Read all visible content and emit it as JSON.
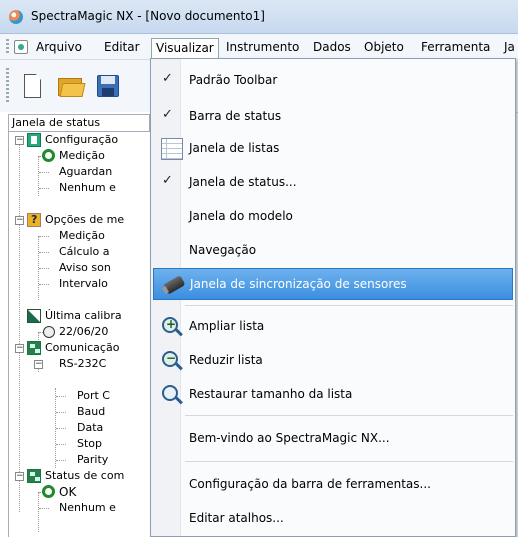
{
  "window": {
    "title": "SpectraMagic NX - [Novo documento1]"
  },
  "menubar": {
    "items": [
      "Arquivo",
      "Editar",
      "Visualizar",
      "Instrumento",
      "Dados",
      "Objeto",
      "Ferramenta",
      "Ja"
    ]
  },
  "status_panel": {
    "title": "Janela de status",
    "nodes": [
      "Configuração",
      "Medição",
      "Aguardan",
      "Nenhum e",
      "Opções de me",
      "Medição",
      "Cálculo a",
      "Aviso son",
      "Intervalo",
      "Última calibra",
      "22/06/20",
      "Comunicação",
      "RS-232C",
      "Port C",
      "Baud",
      "Data",
      "Stop",
      "Parity",
      "Status de com",
      "OK",
      "Nenhum e"
    ]
  },
  "dropdown": {
    "items": [
      {
        "label": "Padrão Toolbar",
        "checked": true,
        "icon": "check-icon"
      },
      {
        "label": "Barra de status",
        "checked": true,
        "icon": "check-icon"
      },
      {
        "label": "Janela de listas",
        "checked": false,
        "icon": "list-window-icon"
      },
      {
        "label": "Janela de status...",
        "checked": true,
        "icon": "check-icon"
      },
      {
        "label": "Janela do modelo",
        "checked": false
      },
      {
        "label": "Navegação",
        "checked": false
      },
      {
        "label": "Janela de sincronização de sensores",
        "checked": false,
        "icon": "sensor-icon",
        "highlighted": true
      },
      {
        "label": "Ampliar lista",
        "icon": "zoom-in-icon"
      },
      {
        "label": "Reduzir lista",
        "icon": "zoom-out-icon"
      },
      {
        "label": "Restaurar tamanho da lista",
        "icon": "zoom-restore-icon"
      },
      {
        "label": "Bem-vindo ao SpectraMagic NX..."
      },
      {
        "label": "Configuração da barra de ferramentas..."
      },
      {
        "label": "Editar atalhos..."
      }
    ]
  },
  "colors": {
    "highlight": "#3b8fe0",
    "titlebar": "#c7d9ef"
  }
}
